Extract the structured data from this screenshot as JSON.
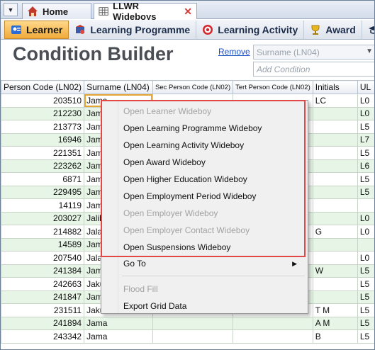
{
  "tabs": [
    {
      "label": "Home",
      "icon": "home-icon"
    },
    {
      "label": "LLWR Wideboys",
      "icon": "grid-icon"
    }
  ],
  "modules": [
    {
      "label": "Learner",
      "icon": "learner-icon",
      "active": true
    },
    {
      "label": "Learning Programme",
      "icon": "learning-programme-icon"
    },
    {
      "label": "Learning Activity",
      "icon": "target-icon"
    },
    {
      "label": "Award",
      "icon": "award-icon"
    },
    {
      "label": "H",
      "icon": "higher-education-icon"
    }
  ],
  "header": {
    "title": "Condition Builder",
    "remove_label": "Remove",
    "condition_field": "Surname (LN04)",
    "add_condition_placeholder": "Add Condition"
  },
  "grid": {
    "columns": [
      "Person Code (LN02)",
      "Surname (LN04)",
      "Sec Person Code (LN02)",
      "Tert Person Code (LN02)",
      "Initials",
      "UL"
    ],
    "rows": [
      {
        "person_code": "203510",
        "surname": "Jama",
        "initials": "LC",
        "ul": "L0"
      },
      {
        "person_code": "212230",
        "surname": "Jama",
        "initials": "",
        "ul": "L0"
      },
      {
        "person_code": "213773",
        "surname": "Jama",
        "initials": "",
        "ul": "L5"
      },
      {
        "person_code": "16946",
        "surname": "Jama",
        "initials": "",
        "ul": "L7"
      },
      {
        "person_code": "221351",
        "surname": "Jama",
        "initials": "",
        "ul": "L5"
      },
      {
        "person_code": "223262",
        "surname": "Jama",
        "initials": "",
        "ul": "L6"
      },
      {
        "person_code": "6871",
        "surname": "Jama",
        "initials": "",
        "ul": "L5"
      },
      {
        "person_code": "229495",
        "surname": "Jama",
        "initials": "",
        "ul": "L5"
      },
      {
        "person_code": "14119",
        "surname": "Jame",
        "initials": "",
        "ul": ""
      },
      {
        "person_code": "203027",
        "surname": "Jalil",
        "initials": "",
        "ul": "L0"
      },
      {
        "person_code": "214882",
        "surname": "Jalali",
        "initials": "G",
        "ul": "L0"
      },
      {
        "person_code": "14589",
        "surname": "Jame",
        "initials": "",
        "ul": ""
      },
      {
        "person_code": "207540",
        "surname": "Jalal",
        "initials": "",
        "ul": "L0"
      },
      {
        "person_code": "241384",
        "surname": "Jama",
        "initials": "W",
        "ul": "L5"
      },
      {
        "person_code": "242663",
        "surname": "Jaku",
        "initials": "",
        "ul": "L5"
      },
      {
        "person_code": "241847",
        "surname": "Jama",
        "initials": "",
        "ul": "L5"
      },
      {
        "person_code": "231511",
        "surname": "Jakubicek",
        "initials": "T M",
        "ul": "L5"
      },
      {
        "person_code": "241894",
        "surname": "Jama",
        "initials": "A M",
        "ul": "L5"
      },
      {
        "person_code": "243342",
        "surname": "Jama",
        "initials": "B",
        "ul": "L5"
      }
    ]
  },
  "context_menu": {
    "items": [
      {
        "label": "Open Learner Wideboy",
        "disabled": true
      },
      {
        "label": "Open Learning Programme Wideboy",
        "disabled": false
      },
      {
        "label": "Open Learning Activity Wideboy",
        "disabled": false
      },
      {
        "label": "Open Award Wideboy",
        "disabled": false
      },
      {
        "label": "Open Higher Education Wideboy",
        "disabled": false
      },
      {
        "label": "Open Employment Period Wideboy",
        "disabled": false
      },
      {
        "label": "Open Employer Wideboy",
        "disabled": true
      },
      {
        "label": "Open Employer Contact Wideboy",
        "disabled": true
      },
      {
        "label": "Open Suspensions Wideboy",
        "disabled": false
      },
      {
        "label": "Go To",
        "disabled": false,
        "submenu": true
      },
      {
        "label": "Flood Fill",
        "disabled": true
      },
      {
        "label": "Export Grid Data",
        "disabled": false
      }
    ]
  },
  "colors": {
    "highlight_border": "#e24848",
    "row_alt": "#e6f5e6",
    "active_module": "#f0a93a",
    "link": "#1a4fc4"
  }
}
